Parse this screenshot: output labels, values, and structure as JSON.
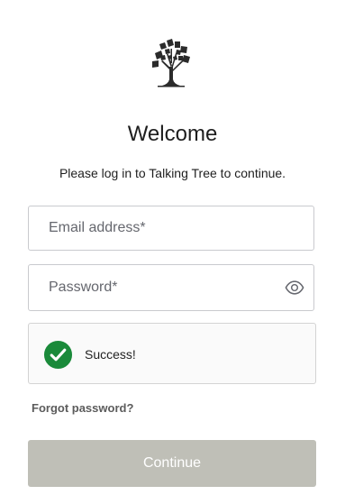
{
  "logo": {
    "icon": "tree-icon"
  },
  "header": {
    "title": "Welcome",
    "subtitle": "Please log in to Talking Tree to continue."
  },
  "form": {
    "email_placeholder": "Email address*",
    "password_placeholder": "Password*",
    "password_toggle_icon": "eye-icon"
  },
  "captcha": {
    "status_text": "Success!",
    "status_icon": "checkmark-circle-icon",
    "status_color": "#1a8a3a"
  },
  "links": {
    "forgot_password": "Forgot password?"
  },
  "actions": {
    "continue_label": "Continue",
    "continue_bg": "#bfbfb7"
  }
}
